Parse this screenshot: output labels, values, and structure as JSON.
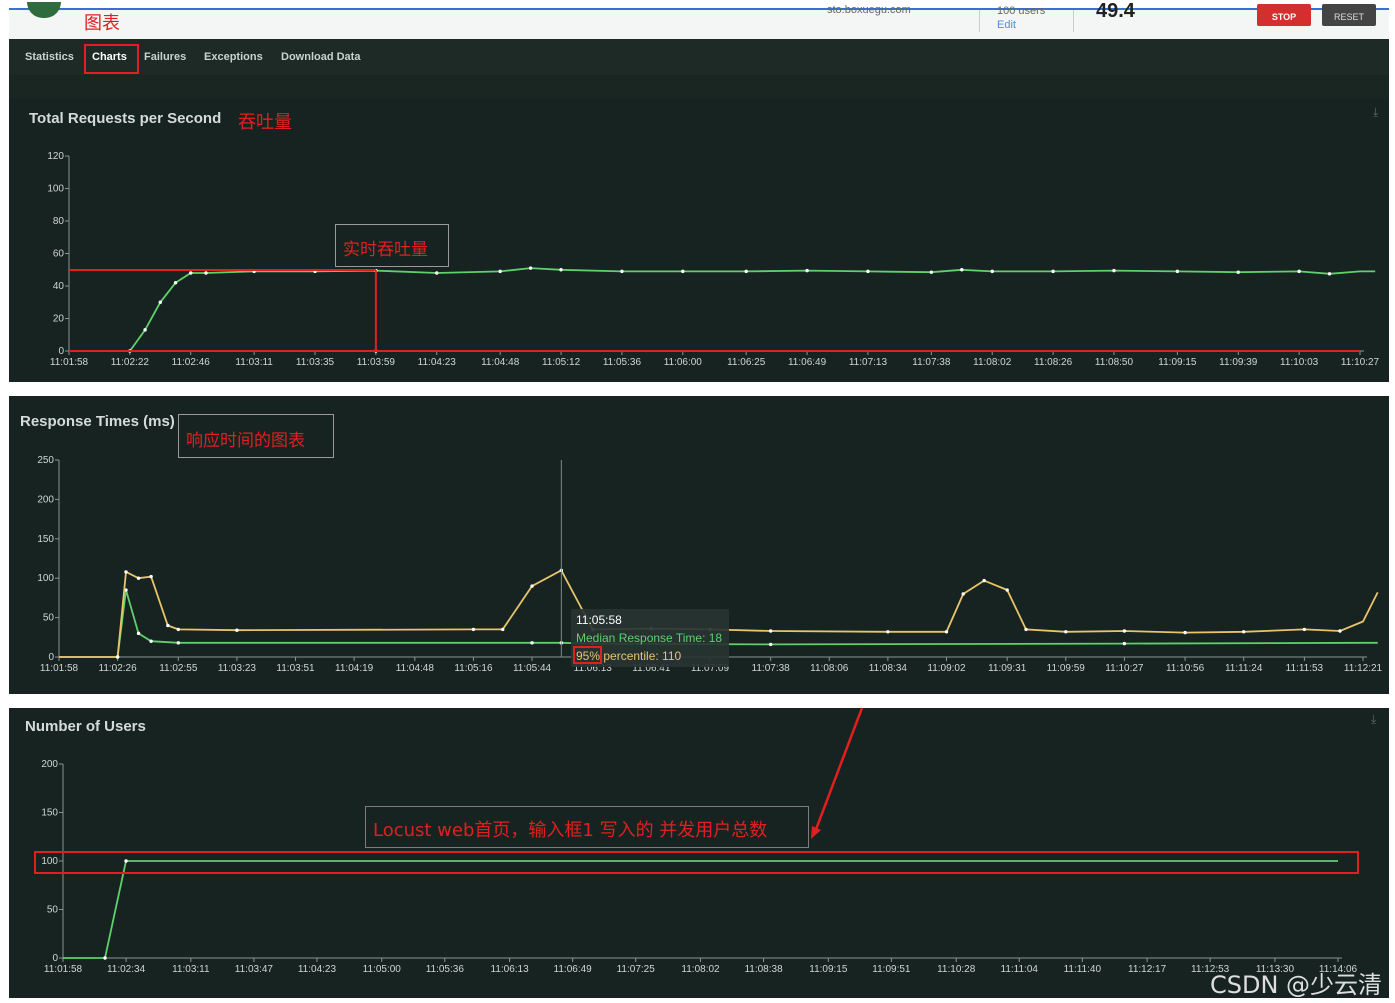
{
  "header": {
    "host": "sto.boxuegu.com",
    "users_line": "100 users",
    "edit_label": "Edit",
    "rps_value": "49.4",
    "stop_label": "STOP",
    "reset_label": "RESET"
  },
  "tabs": [
    {
      "label": "Statistics"
    },
    {
      "label": "Charts"
    },
    {
      "label": "Failures"
    },
    {
      "label": "Exceptions"
    },
    {
      "label": "Download Data"
    }
  ],
  "annotations": {
    "charts_tab_note": "图表",
    "rps_title_note": "吞吐量",
    "rps_box_note": "实时吞吐量",
    "response_box_note": "响应时间的图表",
    "users_box_note": "Locust web首页，输入框1 写入的 并发用户总数"
  },
  "colors": {
    "panel_bg": "#172321",
    "green_series": "#5fd06b",
    "yellow_series": "#e8c46a",
    "annotation_red": "#e02020"
  },
  "chart_data": [
    {
      "type": "line",
      "title": "Total Requests per Second",
      "ylim": [
        0,
        120
      ],
      "yticks": [
        0,
        20,
        40,
        60,
        80,
        100,
        120
      ],
      "x_tick_labels": [
        "11:01:58",
        "11:02:22",
        "11:02:46",
        "11:03:11",
        "11:03:35",
        "11:03:59",
        "11:04:23",
        "11:04:48",
        "11:05:12",
        "11:05:36",
        "11:06:00",
        "11:06:25",
        "11:06:49",
        "11:07:13",
        "11:07:38",
        "11:08:02",
        "11:08:26",
        "11:08:50",
        "11:09:15",
        "11:09:39",
        "11:10:03",
        "11:10:27"
      ],
      "series": [
        {
          "color": "#5fd06b",
          "x": [
            "11:01:58",
            "11:02:22",
            "11:02:28",
            "11:02:34",
            "11:02:40",
            "11:02:46",
            "11:02:52",
            "11:03:11",
            "11:03:35",
            "11:03:59",
            "11:04:23",
            "11:04:48",
            "11:05:00",
            "11:05:12",
            "11:05:36",
            "11:06:00",
            "11:06:25",
            "11:06:49",
            "11:07:13",
            "11:07:38",
            "11:07:50",
            "11:08:02",
            "11:08:26",
            "11:08:50",
            "11:09:15",
            "11:09:39",
            "11:10:03",
            "11:10:15",
            "11:10:27",
            "11:10:33"
          ],
          "values": [
            0,
            0,
            13,
            30,
            42,
            48,
            48,
            49,
            49,
            49.5,
            48,
            49,
            51,
            50,
            49,
            49,
            49,
            49.5,
            49,
            48.5,
            50,
            49,
            49,
            49.5,
            49,
            48.5,
            49,
            47.5,
            49,
            49
          ]
        },
        {
          "color": "#e0302a",
          "x": [
            "11:01:58",
            "11:03:59"
          ],
          "values": [
            0,
            0
          ]
        }
      ]
    },
    {
      "type": "line",
      "title": "Response Times (ms)",
      "ylim": [
        0,
        250
      ],
      "yticks": [
        0,
        50,
        100,
        150,
        200,
        250
      ],
      "x_tick_labels": [
        "11:01:58",
        "11:02:26",
        "11:02:55",
        "11:03:23",
        "11:03:51",
        "11:04:19",
        "11:04:48",
        "11:05:16",
        "11:05:44",
        "11:06:13",
        "11:06:41",
        "11:07:09",
        "11:07:38",
        "11:08:06",
        "11:08:34",
        "11:09:02",
        "11:09:31",
        "11:09:59",
        "11:10:27",
        "11:10:56",
        "11:11:24",
        "11:11:53",
        "11:12:21"
      ],
      "series": [
        {
          "name": "Median Response Time",
          "color": "#5fd06b",
          "x": [
            "11:01:58",
            "11:02:26",
            "11:02:30",
            "11:02:36",
            "11:02:42",
            "11:02:55",
            "11:05:44",
            "11:05:58",
            "11:06:13",
            "11:07:38",
            "11:10:27",
            "11:12:21",
            "11:12:28"
          ],
          "values": [
            0,
            0,
            85,
            30,
            20,
            18,
            18,
            18,
            17,
            16,
            17,
            18,
            18
          ]
        },
        {
          "name": "95% percentile",
          "color": "#e8c46a",
          "x": [
            "11:01:58",
            "11:02:26",
            "11:02:30",
            "11:02:36",
            "11:02:42",
            "11:02:50",
            "11:02:55",
            "11:03:23",
            "11:05:16",
            "11:05:30",
            "11:05:44",
            "11:05:58",
            "11:06:13",
            "11:06:41",
            "11:07:09",
            "11:07:38",
            "11:08:34",
            "11:09:02",
            "11:09:10",
            "11:09:20",
            "11:09:31",
            "11:09:40",
            "11:09:59",
            "11:10:27",
            "11:10:56",
            "11:11:24",
            "11:11:53",
            "11:12:10",
            "11:12:21",
            "11:12:28"
          ],
          "values": [
            0,
            0,
            108,
            100,
            102,
            40,
            35,
            34,
            35,
            35,
            90,
            110,
            35,
            36,
            35,
            33,
            32,
            32,
            80,
            97,
            85,
            35,
            32,
            33,
            31,
            32,
            35,
            33,
            45,
            82
          ]
        }
      ],
      "tooltip": {
        "time": "11:05:58",
        "median_label": "Median Response Time: 18",
        "p95_label": "95% percentile: 110"
      }
    },
    {
      "type": "line",
      "title": "Number of Users",
      "ylim": [
        0,
        200
      ],
      "yticks": [
        0,
        50,
        100,
        150,
        200
      ],
      "x_tick_labels": [
        "11:01:58",
        "11:02:34",
        "11:03:11",
        "11:03:47",
        "11:04:23",
        "11:05:00",
        "11:05:36",
        "11:06:13",
        "11:06:49",
        "11:07:25",
        "11:08:02",
        "11:08:38",
        "11:09:15",
        "11:09:51",
        "11:10:28",
        "11:11:04",
        "11:11:40",
        "11:12:17",
        "11:12:53",
        "11:13:30",
        "11:14:06"
      ],
      "series": [
        {
          "color": "#5fd06b",
          "x": [
            "11:01:58",
            "11:02:22",
            "11:02:34",
            "11:14:06"
          ],
          "values": [
            0,
            0,
            100,
            100
          ]
        }
      ]
    }
  ],
  "watermark": "CSDN @少云清"
}
